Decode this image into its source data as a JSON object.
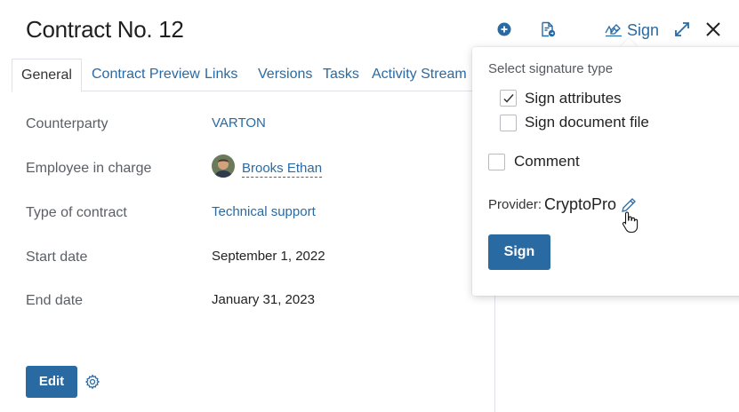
{
  "header": {
    "title": "Contract No. 12",
    "sign_label": "Sign",
    "icons": [
      "add-circle-icon",
      "document-export-icon",
      "signature-icon",
      "expand-icon",
      "close-icon"
    ]
  },
  "tabs": [
    {
      "label": "General",
      "active": true
    },
    {
      "label": "Contract Preview",
      "active": false
    },
    {
      "label": "Links",
      "active": false
    },
    {
      "label": "Versions",
      "active": false
    },
    {
      "label": "Tasks",
      "active": false
    },
    {
      "label": "Activity Stream",
      "active": false
    }
  ],
  "fields": {
    "counterparty": {
      "label": "Counterparty",
      "value": "VARTON"
    },
    "employee": {
      "label": "Employee in charge",
      "value": "Brooks Ethan"
    },
    "type": {
      "label": "Type of contract",
      "value": "Technical support"
    },
    "start": {
      "label": "Start date",
      "value": "September 1, 2022"
    },
    "end": {
      "label": "End date",
      "value": "January 31, 2023"
    }
  },
  "footer": {
    "edit_label": "Edit"
  },
  "sign_popup": {
    "title": "Select signature type",
    "options": [
      {
        "label": "Sign attributes",
        "checked": true
      },
      {
        "label": "Sign document file",
        "checked": false
      }
    ],
    "comment": {
      "label": "Comment",
      "checked": false
    },
    "provider_label": "Provider:",
    "provider_value": "CryptoPro",
    "sign_button": "Sign"
  },
  "colors": {
    "accent": "#2a6aa3",
    "text": "#222222",
    "muted": "#5a5f66",
    "border": "#dfe3e7"
  }
}
